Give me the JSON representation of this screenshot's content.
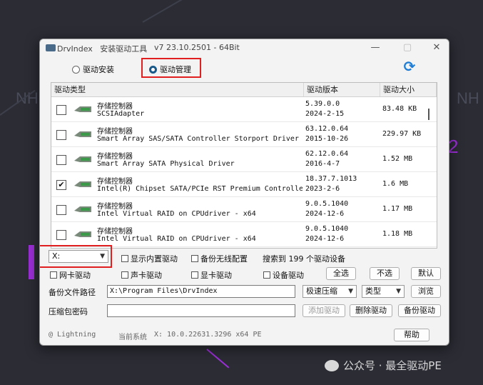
{
  "background": {
    "deco_left": "NH",
    "deco_right": "NH",
    "deco_right2": "2"
  },
  "titlebar": {
    "app_name": "DrvIndex",
    "subtitle": "安装驱动工具",
    "version": "v7  23.10.2501   - 64Bit",
    "minimize": "—",
    "maximize": "▢",
    "close": "✕"
  },
  "mode": {
    "install_label": "驱动安装",
    "manage_label": "驱动管理",
    "selected": "manage"
  },
  "table": {
    "headers": [
      "驱动类型",
      "驱动版本",
      "驱动大小"
    ],
    "rows": [
      {
        "checked": false,
        "type": "存储控制器",
        "name": "SCSIAdapter",
        "version": "5.39.0.0",
        "date": "2024-2-15",
        "size": "83.48 KB"
      },
      {
        "checked": false,
        "type": "存储控制器",
        "name": "Smart Array SAS/SATA Controller Storport Driver",
        "version": "63.12.0.64",
        "date": "2015-10-26",
        "size": "229.97 KB"
      },
      {
        "checked": false,
        "type": "存储控制器",
        "name": "Smart Array SATA Physical Driver",
        "version": "62.12.0.64",
        "date": "2016-4-7",
        "size": "1.52 MB"
      },
      {
        "checked": true,
        "type": "存储控制器",
        "name": "Intel(R) Chipset SATA/PCIe RST Premium Controller",
        "version": "18.37.7.1013",
        "date": "2023-2-6",
        "size": "1.6 MB"
      },
      {
        "checked": false,
        "type": "存储控制器",
        "name": "Intel Virtual RAID on CPUdriver - x64",
        "version": "9.0.5.1040",
        "date": "2024-12-6",
        "size": "1.17 MB"
      },
      {
        "checked": false,
        "type": "存储控制器",
        "name": "Intel Virtual RAID on CPUdriver - x64",
        "version": "9.0.5.1040",
        "date": "2024-12-6",
        "size": "1.18 MB"
      }
    ]
  },
  "controls": {
    "drive_select": "X:",
    "show_builtin": "显示内置驱动",
    "backup_wireless": "备份无线配置",
    "search_result": "搜索到 199 个驱动设备",
    "network": "网卡驱动",
    "sound": "声卡驱动",
    "display": "显卡驱动",
    "device": "设备驱动",
    "select_all": "全选",
    "deselect": "不选",
    "default": "默认",
    "backup_path_label": "备份文件路径",
    "backup_path_value": "X:\\Program Files\\DrvIndex",
    "compress_select": "极速压缩",
    "type_select": "类型",
    "browse": "浏览",
    "password_label": "压缩包密码",
    "password_value": "",
    "add_driver": "添加驱动",
    "delete_driver": "删除驱动",
    "backup_driver": "备份驱动"
  },
  "statusbar": {
    "author": "@ Lightning",
    "system_label": "当前系统",
    "system_value": "X: 10.0.22631.3296 x64  PE",
    "help": "帮助"
  },
  "watermark": {
    "text": "公众号 · 最全驱动PE"
  },
  "colors": {
    "highlight": "#e02020",
    "accent": "#1f7dd6",
    "background": "#2b2c34"
  }
}
